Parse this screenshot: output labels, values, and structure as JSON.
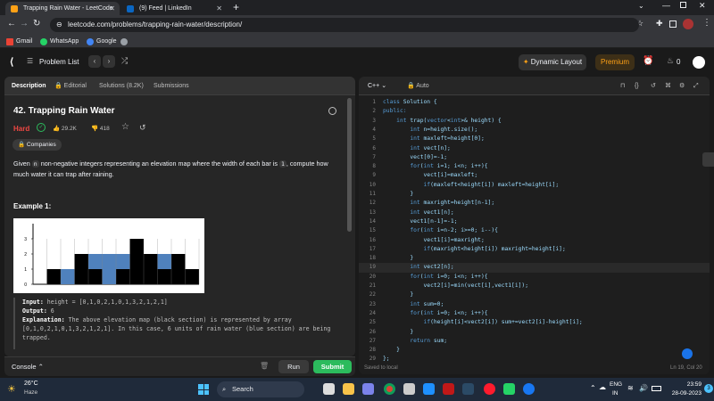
{
  "browser": {
    "tabs": [
      {
        "title": "Trapping Rain Water - LeetCode",
        "active": true
      },
      {
        "title": "(9) Feed | LinkedIn",
        "active": false
      }
    ],
    "url": "leetcode.com/problems/trapping-rain-water/description/",
    "bookmarks": [
      "Gmail",
      "WhatsApp",
      "Google"
    ]
  },
  "header": {
    "problem_list": "Problem List",
    "dynamic_layout": "Dynamic Layout",
    "premium": "Premium",
    "points": "0"
  },
  "left": {
    "tabs": [
      "Description",
      "Editorial",
      "Solutions (8.2K)",
      "Submissions"
    ],
    "title": "42. Trapping Rain Water",
    "difficulty": "Hard",
    "likes": "29.2K",
    "dislikes": "418",
    "companies": "Companies",
    "desc_before": "Given ",
    "desc_n": "n",
    "desc_middle": " non-negative integers representing an elevation map where the width of each bar is ",
    "desc_one": "1",
    "desc_after": ", compute how much water it can trap after raining.",
    "example_title": "Example 1:",
    "input_label": "Input:",
    "input_value": " height = [0,1,0,2,1,0,1,3,2,1,2,1]",
    "output_label": "Output:",
    "output_value": " 6",
    "explanation_label": "Explanation:",
    "explanation_text": " The above elevation map (black section) is represented by array [0,1,0,2,1,0,1,3,2,1,2,1]. In this case, 6 units of rain water (blue section) are being trapped.",
    "console": "Console",
    "run": "Run",
    "submit": "Submit"
  },
  "elevation": {
    "heights": [
      0,
      1,
      0,
      2,
      1,
      0,
      1,
      3,
      2,
      1,
      2,
      1
    ],
    "water": [
      0,
      0,
      1,
      0,
      1,
      2,
      1,
      0,
      0,
      1,
      0,
      0
    ],
    "y_ticks": [
      "0",
      "1",
      "2",
      "3"
    ],
    "bar_color": "#000000",
    "water_color": "#4f81bd"
  },
  "editor": {
    "language": "C++",
    "mode": "Auto",
    "lines": [
      "class Solution {",
      "public:",
      "    int trap(vector<int>& height) {",
      "        int n=height.size();",
      "        int maxleft=height[0];",
      "        int vect[n];",
      "        vect[0]=-1;",
      "        for(int i=1; i<n; i++){",
      "            vect[i]=maxleft;",
      "            if(maxleft<height[i]) maxleft=height[i];",
      "        }",
      "        int maxright=height[n-1];",
      "        int vect1[n];",
      "        vect1[n-1]=-1;",
      "        for(int i=n-2; i>=0; i--){",
      "            vect1[i]=maxright;",
      "            if(maxright<height[i]) maxright=height[i];",
      "        }",
      "        int vect2[n];",
      "        for(int i=0; i<n; i++){",
      "            vect2[i]=min(vect[i],vect1[i]);",
      "        }",
      "        int sum=0;",
      "        for(int i=0; i<n; i++){",
      "            if(height[i]<vect2[i]) sum+=vect2[i]-height[i];",
      "        }",
      "        return sum;",
      "    }",
      "};"
    ],
    "status_left": "Saved to local",
    "status_right": "Ln 19, Col 20"
  },
  "taskbar": {
    "weather_temp": "26°C",
    "weather_desc": "Haze",
    "search": "Search",
    "lang1": "ENG",
    "lang2": "IN",
    "time": "23:59",
    "date": "28-09-2023",
    "notif": "3"
  },
  "colors": {
    "hard": "#ef4743",
    "accent_green": "#2cbb5d",
    "premium": "#ffa116"
  }
}
